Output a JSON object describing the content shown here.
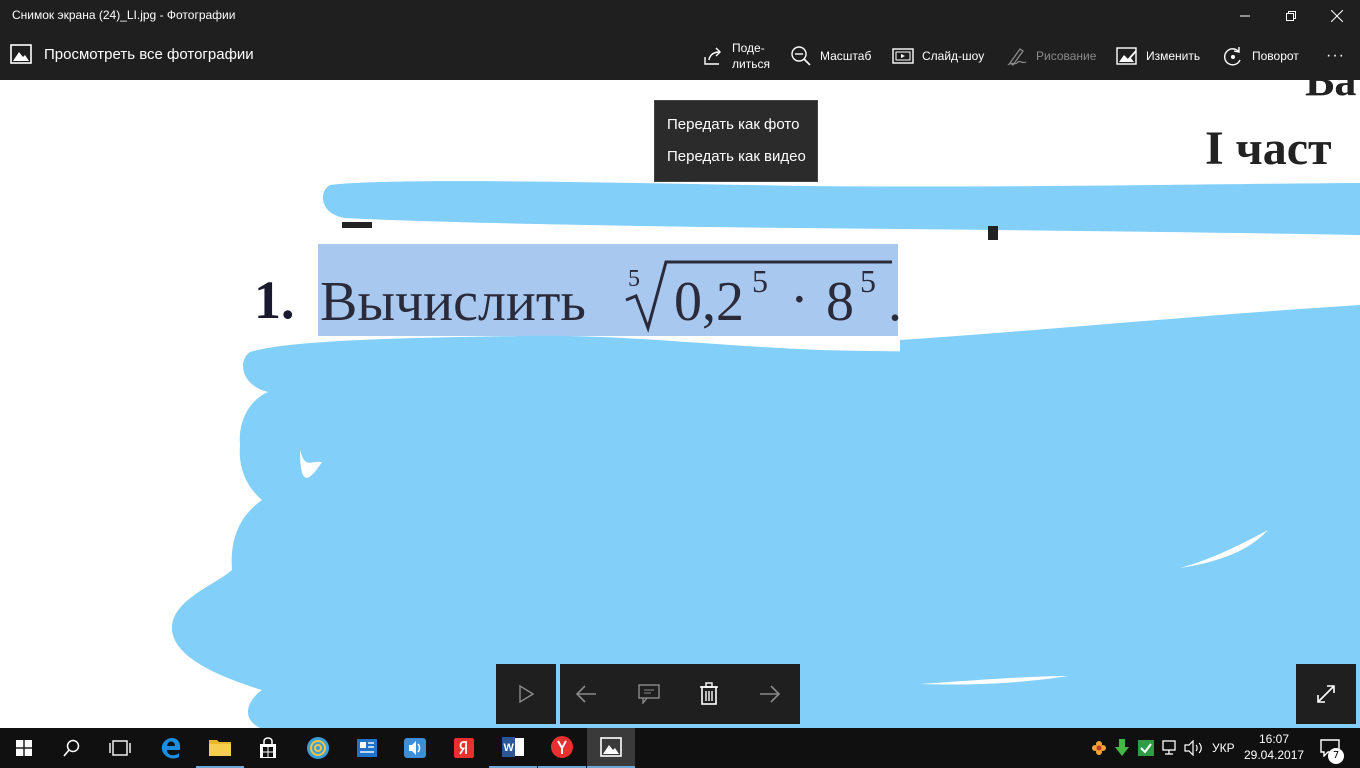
{
  "window": {
    "title": "Снимок экрана (24)_LI.jpg - Фотографии"
  },
  "appbar": {
    "back_label": "Просмотреть все фотографии",
    "tools": {
      "share": "Поде-\nлиться",
      "share_line1": "Поде-",
      "share_line2": "литься",
      "zoom": "Масштаб",
      "slideshow": "Слайд-шоу",
      "draw": "Рисование",
      "edit": "Изменить",
      "rotate": "Поворот",
      "more": "···"
    }
  },
  "share_menu": {
    "items": [
      "Передать как фото",
      "Передать как видео"
    ]
  },
  "image_content": {
    "heading_fragment_1": "Ва",
    "heading_fragment_2": "I част",
    "problem_number": "1.",
    "problem_text": "Вычислить",
    "root_index": "5",
    "radicand": "0,2",
    "exp1": "5",
    "dot": "·",
    "base2": "8",
    "exp2": "5",
    "period": "."
  },
  "taskbar": {
    "language": "УКР",
    "time": "16:07",
    "date": "29.04.2017",
    "notification_count": "7"
  },
  "colors": {
    "chrome": "#1f1f1f",
    "taskbar": "#101010",
    "scribble": "#82cffa",
    "selection": "#a9c8f0",
    "accent": "#6fa7d6"
  }
}
